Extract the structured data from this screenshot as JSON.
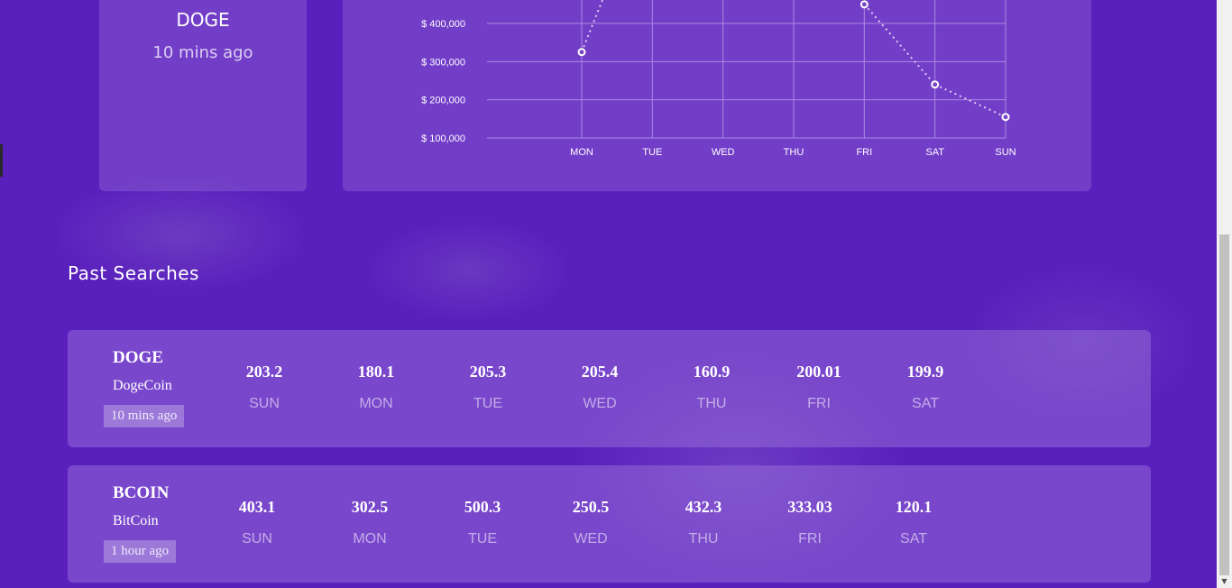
{
  "current": {
    "symbol": "DOGE",
    "updated": "10 mins ago"
  },
  "chart_data": {
    "type": "line",
    "categories": [
      "MON",
      "TUE",
      "WED",
      "THU",
      "FRI",
      "SAT",
      "SUN"
    ],
    "series": [
      {
        "values": [
          325000,
          null,
          null,
          null,
          450000,
          240000,
          155000
        ]
      }
    ],
    "y_ticks": [
      "$ 100,000",
      "$ 200,000",
      "$ 300,000",
      "$ 400,000"
    ],
    "ylim": [
      100000,
      400000
    ],
    "grid": true,
    "line_style": "dotted",
    "colors": {
      "line": "#e2c9f0",
      "grid": "#a98be0",
      "point_fill": "#ffffff",
      "point_stroke": "#7b45c8"
    }
  },
  "past_searches": {
    "title": "Past Searches",
    "items": [
      {
        "symbol": "DOGE",
        "name": "DogeCoin",
        "time": "10 mins ago",
        "days": [
          {
            "value": "203.2",
            "label": "SUN"
          },
          {
            "value": "180.1",
            "label": "MON"
          },
          {
            "value": "205.3",
            "label": "TUE"
          },
          {
            "value": "205.4",
            "label": "WED"
          },
          {
            "value": "160.9",
            "label": "THU"
          },
          {
            "value": "200.01",
            "label": "FRI"
          },
          {
            "value": "199.9",
            "label": "SAT"
          }
        ]
      },
      {
        "symbol": "BCOIN",
        "name": "BitCoin",
        "time": "1 hour ago",
        "days": [
          {
            "value": "403.1",
            "label": "SUN"
          },
          {
            "value": "302.5",
            "label": "MON"
          },
          {
            "value": "500.3",
            "label": "TUE"
          },
          {
            "value": "250.5",
            "label": "WED"
          },
          {
            "value": "432.3",
            "label": "THU"
          },
          {
            "value": "333.03",
            "label": "FRI"
          },
          {
            "value": "120.1",
            "label": "SAT"
          }
        ]
      }
    ]
  },
  "colors": {
    "background": "#5a20bd",
    "card": "#8e5fd6"
  },
  "icons": {
    "scroll_down": "triangle-down"
  }
}
